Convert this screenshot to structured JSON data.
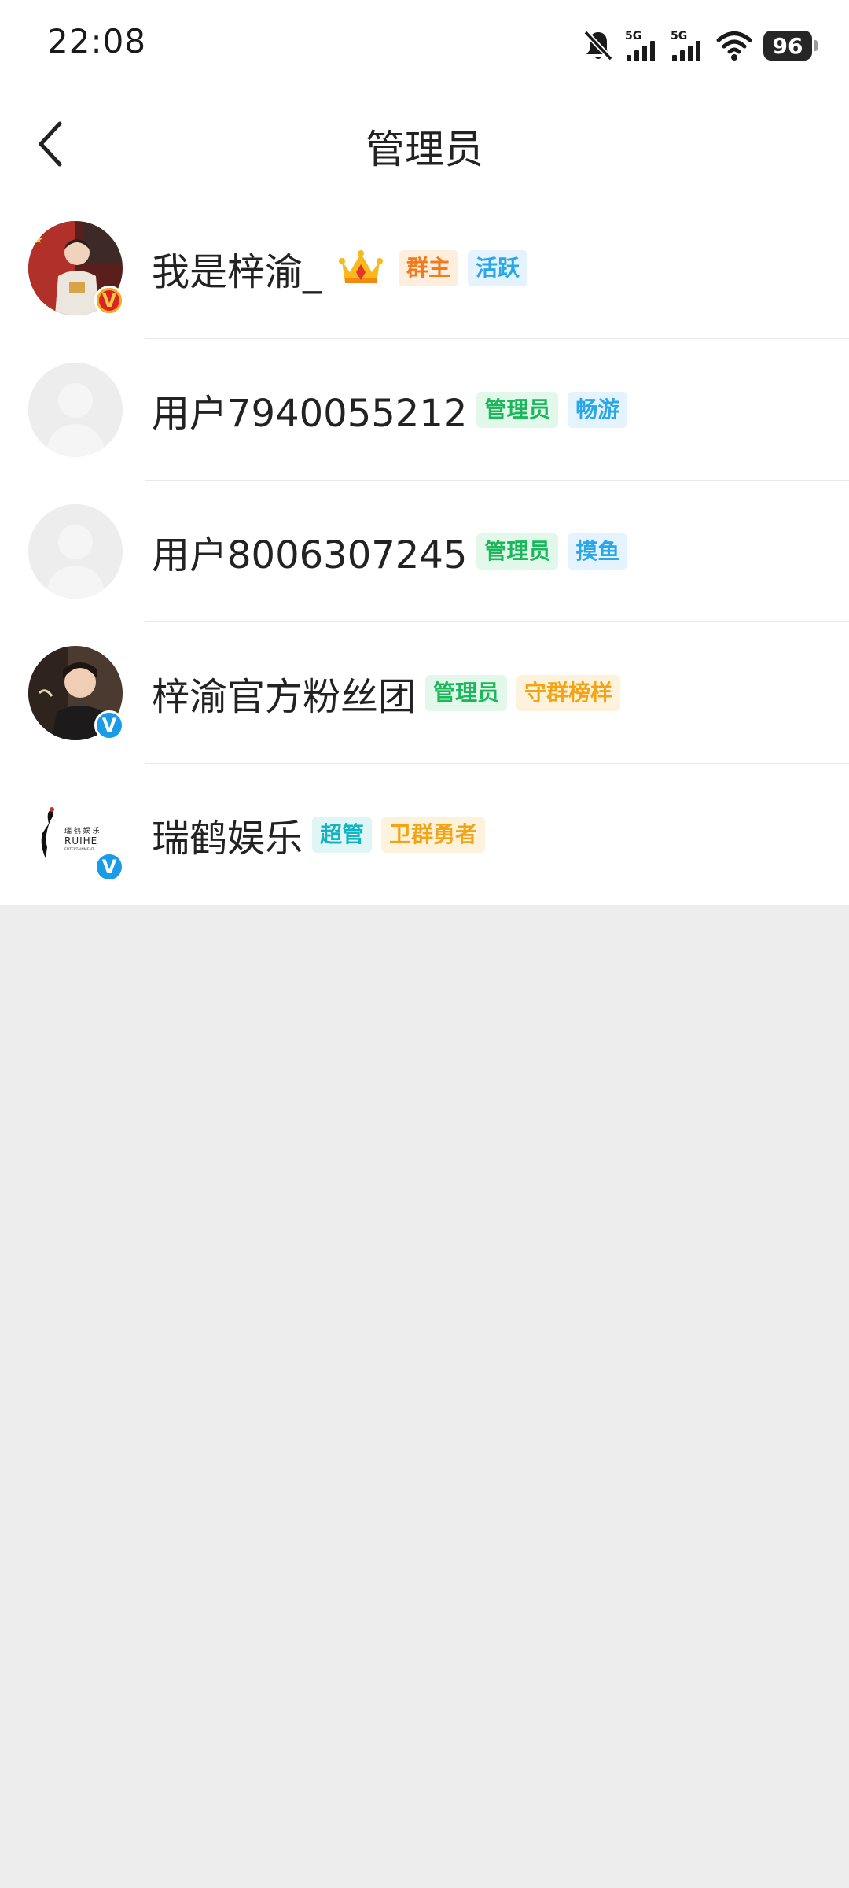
{
  "status_bar": {
    "time": "22:08",
    "battery": "96",
    "signal1_label": "5G",
    "signal2_label": "5G",
    "icons": [
      "bell-muted-icon",
      "signal-5g-icon",
      "signal-5g-icon",
      "wifi-icon",
      "battery-icon"
    ]
  },
  "header": {
    "title": "管理员",
    "back_icon": "chevron-left-icon"
  },
  "members": [
    {
      "name": "我是梓渝_",
      "crown": true,
      "badge": "gold",
      "tags": [
        {
          "label": "群主",
          "style": "orange"
        },
        {
          "label": "活跃",
          "style": "blue"
        }
      ]
    },
    {
      "name": "用户7940055212",
      "crown": false,
      "badge": "",
      "tags": [
        {
          "label": "管理员",
          "style": "green"
        },
        {
          "label": "畅游",
          "style": "blue"
        }
      ]
    },
    {
      "name": "用户8006307245",
      "crown": false,
      "badge": "",
      "tags": [
        {
          "label": "管理员",
          "style": "green"
        },
        {
          "label": "摸鱼",
          "style": "blue"
        }
      ]
    },
    {
      "name": "梓渝官方粉丝团",
      "crown": false,
      "badge": "blue",
      "tags": [
        {
          "label": "管理员",
          "style": "green"
        },
        {
          "label": "守群榜样",
          "style": "gold"
        }
      ]
    },
    {
      "name": "瑞鹤娱乐",
      "crown": false,
      "badge": "blue",
      "logo_text": {
        "cn": "瑞 鹤 娱 乐",
        "en": "RUIHE",
        "sub": "ENTERTAINMENT"
      },
      "tags": [
        {
          "label": "超管",
          "style": "teal"
        },
        {
          "label": "卫群勇者",
          "style": "gold"
        }
      ]
    }
  ],
  "colors": {
    "page_background": "#ededed",
    "list_background": "#ffffff",
    "verify_blue": "#1a9be8"
  }
}
